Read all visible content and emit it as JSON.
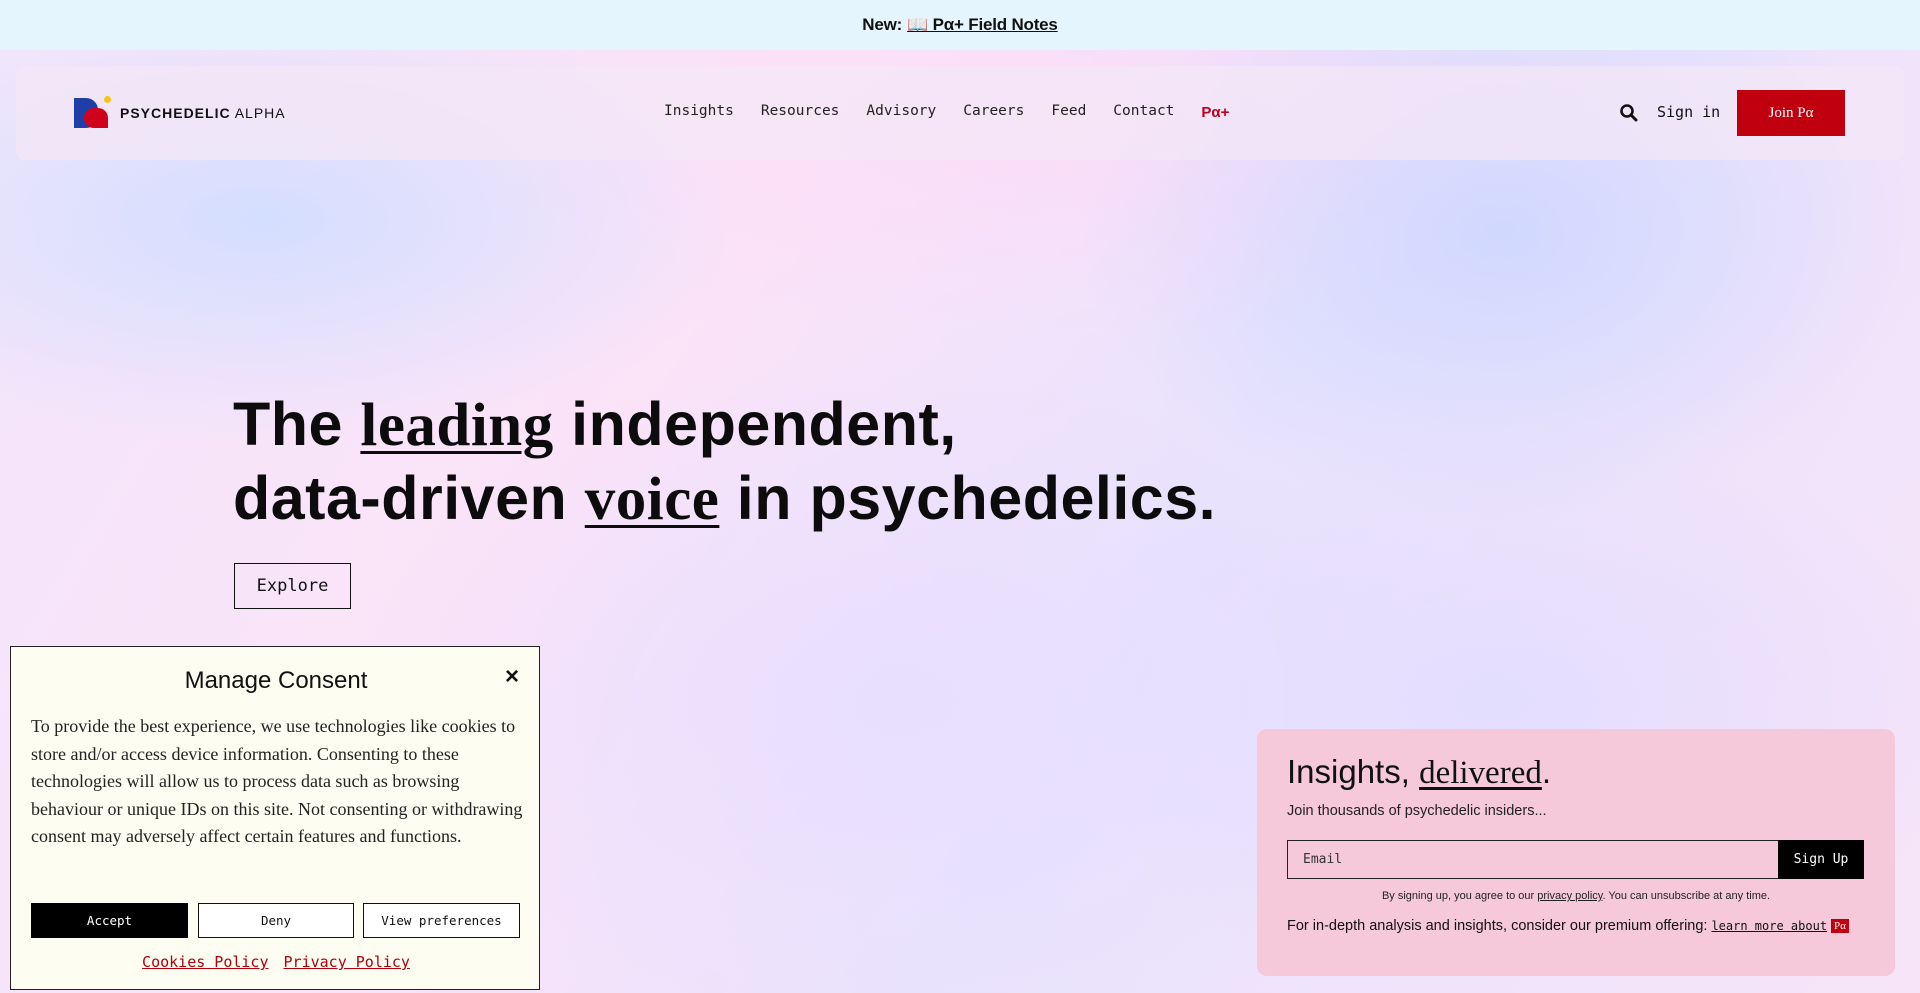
{
  "announcement": {
    "prefix": "New:",
    "link_text": "📖 Pα+ Field Notes"
  },
  "header": {
    "logo_bold": "PSYCHEDELIC",
    "logo_light": "ALPHA",
    "nav": [
      "Insights",
      "Resources",
      "Advisory",
      "Careers",
      "Feed",
      "Contact"
    ],
    "nav_plus": "Pα+",
    "signin": "Sign in",
    "join": "Join Pα"
  },
  "hero": {
    "line1_pre": "The ",
    "line1_em": "leading",
    "line1_post": " independent,",
    "line2_pre": "data-driven ",
    "line2_em": "voice",
    "line2_post": " in psychedelics.",
    "explore": "Explore"
  },
  "consent": {
    "title": "Manage Consent",
    "close": "×",
    "body": "To provide the best experience, we use technologies like cookies to store and/or access device information. Consenting to these technologies will allow us to process data such as browsing behaviour or unique IDs on this site. Not consenting or withdrawing consent may adversely affect certain features and functions.",
    "accept": "Accept",
    "deny": "Deny",
    "prefs": "View preferences",
    "cookies_policy": "Cookies Policy",
    "privacy_policy": "Privacy Policy"
  },
  "newsletter": {
    "title_pre": "Insights, ",
    "title_em": "delivered",
    "title_post": ".",
    "subtitle": "Join thousands of psychedelic insiders...",
    "email_placeholder": "Email",
    "signup": "Sign Up",
    "fine_pre": "By signing up, you agree to our ",
    "fine_link": "privacy policy",
    "fine_post": ". You can unsubscribe at any time.",
    "premium": "For in-depth analysis and insights, consider our premium offering:",
    "learn_more": "learn more about",
    "badge": "Pα"
  },
  "colors": {
    "brand_red": "#c1000f",
    "brand_blue": "#1f3ea8",
    "newsletter_bg": "#f6c9da",
    "consent_bg": "#fefdf2"
  }
}
